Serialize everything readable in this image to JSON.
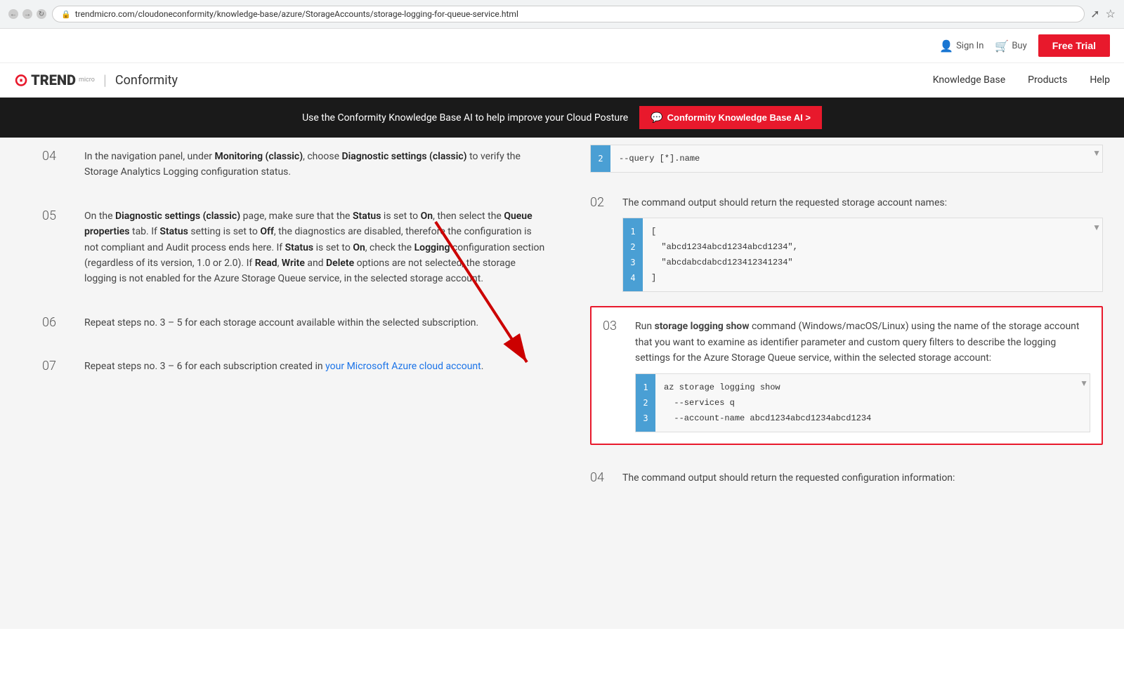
{
  "browser": {
    "url": "trendmicro.com/cloudoneconformity/knowledge-base/azure/StorageAccounts/storage-logging-for-queue-service.html",
    "back_title": "Back",
    "forward_title": "Forward",
    "refresh_title": "Refresh"
  },
  "topbar": {
    "signin_label": "Sign In",
    "buy_label": "Buy",
    "free_trial_label": "Free Trial"
  },
  "nav": {
    "brand_trend": "TREND",
    "brand_micro": "micro",
    "brand_conformity": "Conformity",
    "links": [
      {
        "label": "Knowledge Base"
      },
      {
        "label": "Products"
      },
      {
        "label": "Help"
      }
    ]
  },
  "banner": {
    "text": "Use the Conformity Knowledge Base AI to help improve your Cloud Posture",
    "cta_label": "Conformity Knowledge Base AI >"
  },
  "left_steps": [
    {
      "num": "04",
      "html": "In the navigation panel, under <b>Monitoring (classic)</b>, choose <b>Diagnostic settings (classic)</b> to verify the Storage Analytics Logging configuration status."
    },
    {
      "num": "05",
      "html": "On the <b>Diagnostic settings (classic)</b> page, make sure that the <b>Status</b> is set to <b>On</b>, then select the <b>Queue properties</b> tab. If <b>Status</b> setting is set to <b>Off</b>, the diagnostics are disabled, therefore the configuration is not compliant and Audit process ends here. If <b>Status</b> is set to <b>On</b>, check the <b>Logging</b> configuration section (regardless of its version, 1.0 or 2.0). If <b>Read</b>, <b>Write</b> and <b>Delete</b> options are not selected, the storage logging is not enabled for the Azure Storage Queue service, in the selected storage account."
    },
    {
      "num": "06",
      "html": "Repeat steps no. 3 – 5 for each storage account available within the selected subscription."
    },
    {
      "num": "07",
      "html": "Repeat steps no. 3 – 6 for each subscription created in your Microsoft Azure cloud account."
    }
  ],
  "right_steps": [
    {
      "num": "02",
      "text": "The command output should return the requested storage account names:",
      "code_lines": [
        "[",
        "  \"abcd1234abcd1234abcd1234\",",
        "  \"abcdabcdabcd123412341234\"",
        "]"
      ],
      "line_count": 4,
      "highlighted": false
    },
    {
      "num": "03",
      "text": "Run storage logging show command (Windows/macOS/Linux) using the name of the storage account that you want to examine as identifier parameter and custom query filters to describe the logging settings for the Azure Storage Queue service, within the selected storage account:",
      "code_lines": [
        "az storage logging show",
        "  --services q",
        "  --account-name abcd1234abcd1234abcd1234"
      ],
      "line_count": 3,
      "highlighted": true
    },
    {
      "num": "04",
      "text": "The command output should return the requested configuration information:",
      "code_lines": [],
      "line_count": 0,
      "highlighted": false
    }
  ],
  "code_block_02": {
    "lines": [
      "[",
      "  \"abcd1234abcd1234abcd1234\",",
      "  \"abcdabcdabcd123412341234\"",
      "]"
    ],
    "line_nums": [
      "1",
      "2",
      "3",
      "4"
    ]
  },
  "code_block_pre": {
    "lines": [
      "--query [*].name"
    ],
    "line_nums": [
      "2"
    ]
  },
  "code_block_03": {
    "lines": [
      "az storage logging show",
      "  --services q",
      "  --account-name abcd1234abcd1234abcd1234"
    ],
    "line_nums": [
      "1",
      "2",
      "3"
    ]
  }
}
